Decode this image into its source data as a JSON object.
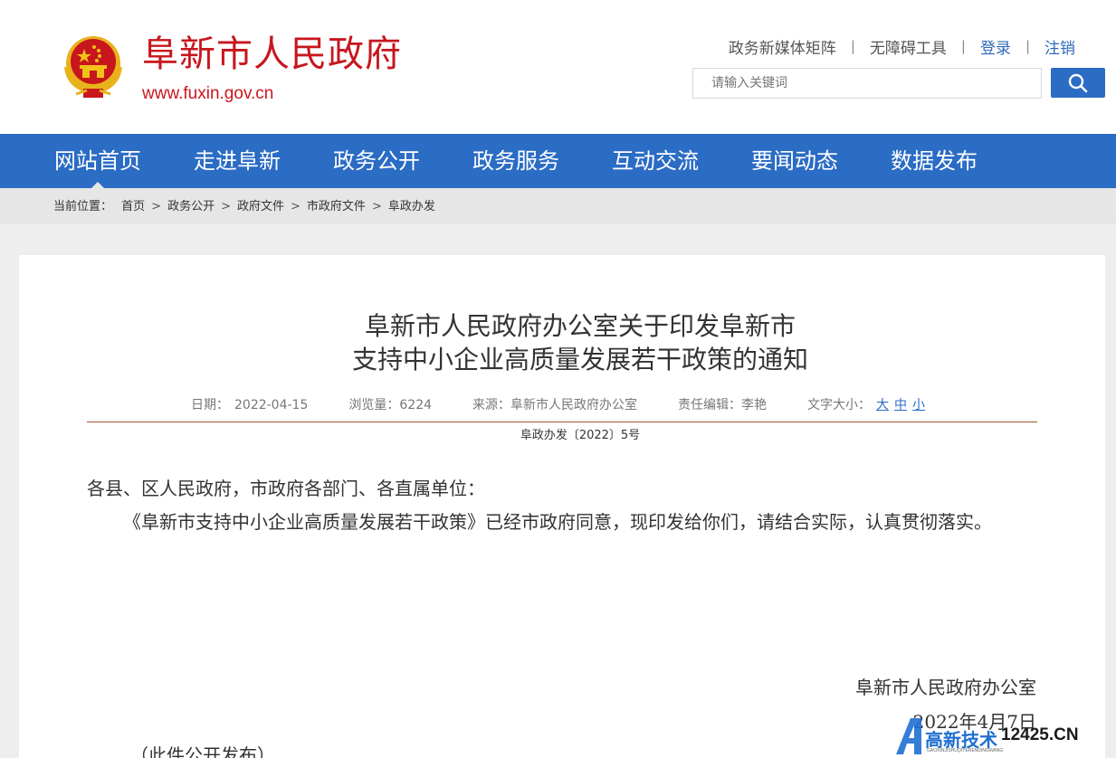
{
  "header": {
    "site_name": "阜新市人民政府",
    "site_url": "www.fuxin.gov.cn",
    "top_links": [
      "政务新媒体矩阵",
      "无障碍工具",
      "登录",
      "注销"
    ],
    "search_placeholder": "请输入关键词"
  },
  "nav": {
    "items": [
      "网站首页",
      "走进阜新",
      "政务公开",
      "政务服务",
      "互动交流",
      "要闻动态",
      "数据发布"
    ],
    "active_index": 0
  },
  "breadcrumb": {
    "label": "当前位置：",
    "items": [
      "首页",
      "政务公开",
      "政府文件",
      "市政府文件",
      "阜政办发"
    ]
  },
  "article": {
    "title_line1": "阜新市人民政府办公室关于印发阜新市",
    "title_line2": "支持中小企业高质量发展若干政策的通知",
    "meta": {
      "date_label": "日期：",
      "date": "2022-04-15",
      "views_label": "浏览量：",
      "views": "6224",
      "source_label": "来源：",
      "source": "阜新市人民政府办公室",
      "editor_label": "责任编辑：",
      "editor": "李艳",
      "font_size_label": "文字大小：",
      "font_sizes": [
        "大",
        "中",
        "小"
      ]
    },
    "doc_number": "阜政办发〔2022〕5号",
    "salutation": "各县、区人民政府，市政府各部门、各直属单位：",
    "paragraph": "《阜新市支持中小企业高质量发展若干政策》已经市政府同意，现印发给你们，请结合实际，认真贯彻落实。",
    "sign_org": "阜新市人民政府办公室",
    "sign_date": "2022年4月7日",
    "public_note": "（此件公开发布）"
  },
  "watermark": {
    "text_cn": "高新技术",
    "text_num": "12425.CN",
    "text_small": "GAOXINJISHUQIYERENDINGWANG"
  },
  "colors": {
    "brand_red": "#c8161d",
    "nav_blue": "#2b6cc4",
    "rule_brown": "#a0522d"
  }
}
